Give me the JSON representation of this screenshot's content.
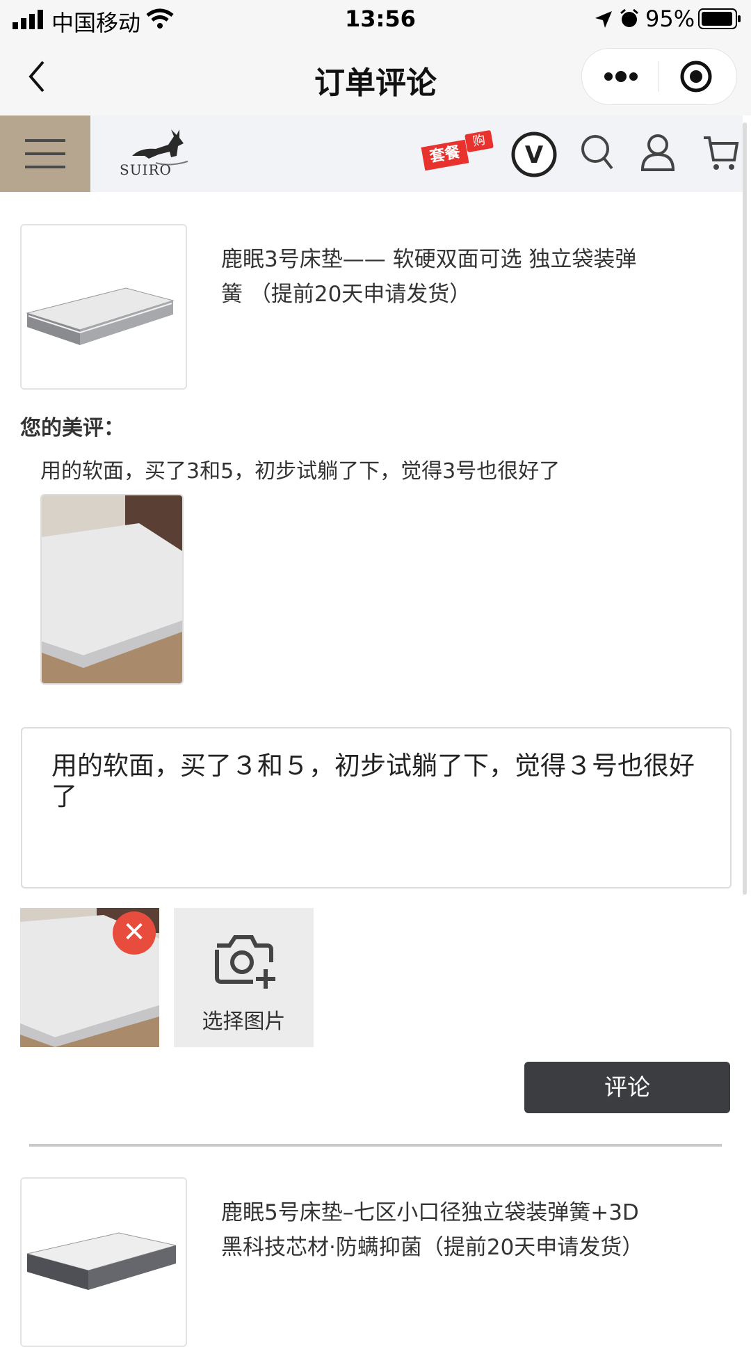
{
  "status_bar": {
    "carrier": "中国移动",
    "time": "13:56",
    "battery": "95%"
  },
  "title_bar": {
    "title": "订单评论"
  },
  "site_nav": {
    "brand": "SUIRO",
    "combo_badge": "套餐",
    "combo_badge_small": "购",
    "vip_letter": "V"
  },
  "orders": [
    {
      "product_name": "鹿眠3号床垫—— 软硬双面可选 独立袋装弹簧 （提前20天申请发货）",
      "review_label": "您的美评：",
      "review_text": "用的软面，买了3和5，初步试躺了下，觉得3号也很好了",
      "comment_value": "用的软面，买了３和５，初步试躺了下，觉得３号也很好了",
      "choose_image_label": "选择图片",
      "submit_label": "评论"
    },
    {
      "product_name": "鹿眠5号床垫–七区小口径独立袋装弹簧+3D黑科技芯材·防螨抑菌（提前20天申请发货）"
    }
  ],
  "colors": {
    "accent_dark": "#3b3d40",
    "remove_red": "#e84c3d",
    "nav_menu_bg": "#b6a68f",
    "combo_red": "#e8322e"
  }
}
